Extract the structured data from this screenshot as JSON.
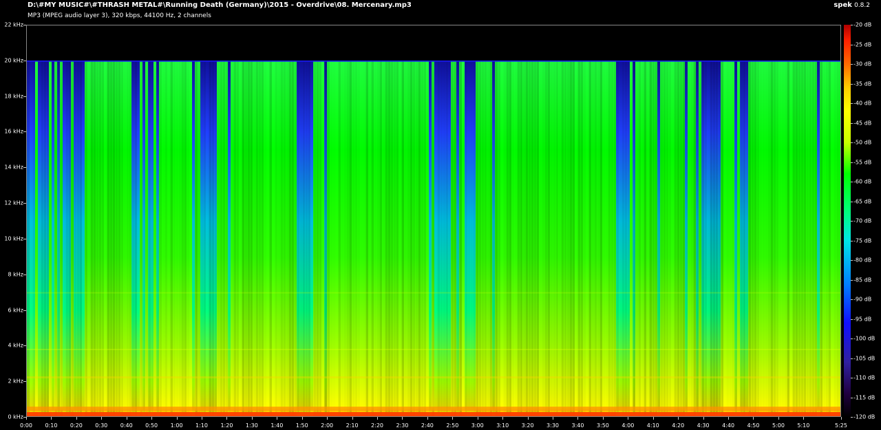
{
  "header": {
    "file_path": "D:\\#MY MUSIC#\\#THRASH METAL#\\Running Death (Germany)\\2015 - Overdrive\\08. Mercenary.mp3",
    "file_info": "MP3 (MPEG audio layer 3), 320 kbps, 44100 Hz, 2 channels"
  },
  "brand": {
    "name": "spek",
    "version": "0.8.2"
  },
  "axes": {
    "y_labels": [
      "22 kHz",
      "20 kHz",
      "18 kHz",
      "16 kHz",
      "14 kHz",
      "12 kHz",
      "10 kHz",
      "8 kHz",
      "6 kHz",
      "4 kHz",
      "2 kHz",
      "0 kHz"
    ],
    "x_labels": [
      "0:00",
      "0:10",
      "0:20",
      "0:30",
      "0:40",
      "0:50",
      "1:00",
      "1:10",
      "1:20",
      "1:30",
      "1:40",
      "1:50",
      "2:00",
      "2:10",
      "2:20",
      "2:30",
      "2:40",
      "2:50",
      "3:00",
      "3:10",
      "3:20",
      "3:30",
      "3:40",
      "3:50",
      "4:00",
      "4:10",
      "4:20",
      "4:30",
      "4:40",
      "4:50",
      "5:00",
      "5:10",
      "5:25"
    ],
    "db_labels": [
      "-20 dB",
      "-25 dB",
      "-30 dB",
      "-35 dB",
      "-40 dB",
      "-45 dB",
      "-50 dB",
      "-55 dB",
      "-60 dB",
      "-65 dB",
      "-70 dB",
      "-75 dB",
      "-80 dB",
      "-85 dB",
      "-90 dB",
      "-95 dB",
      "-100 dB",
      "-105 dB",
      "-110 dB",
      "-115 dB",
      "-120 dB"
    ]
  },
  "spectrogram": {
    "max_frequency_khz": 22,
    "cutoff_frequency_khz": 20,
    "duration_seconds": 325,
    "db_range": [
      -120,
      -20
    ],
    "quiet_sections_seconds": [
      [
        0,
        22
      ],
      [
        40,
        50
      ],
      [
        65,
        75
      ],
      [
        106,
        112
      ],
      [
        160,
        178
      ],
      [
        234,
        240
      ],
      [
        268,
        278
      ],
      [
        282,
        287
      ]
    ]
  }
}
